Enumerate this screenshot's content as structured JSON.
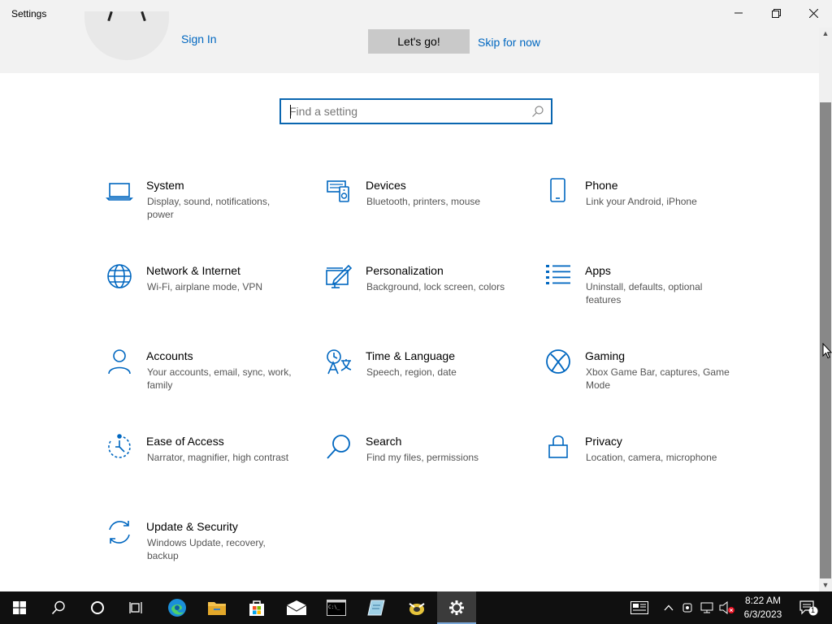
{
  "window": {
    "title": "Settings",
    "minimize_icon": "minimize-icon",
    "restore_icon": "restore-icon",
    "close_icon": "close-icon"
  },
  "banner": {
    "sign_in": "Sign In",
    "lets_go": "Let's go!",
    "skip": "Skip for now"
  },
  "search": {
    "placeholder": "Find a setting",
    "icon": "search-icon"
  },
  "accent_color": "#0067c0",
  "categories": [
    {
      "name": "System",
      "desc": "Display, sound, notifications, power",
      "icon": "laptop-icon"
    },
    {
      "name": "Devices",
      "desc": "Bluetooth, printers, mouse",
      "icon": "devices-icon"
    },
    {
      "name": "Phone",
      "desc": "Link your Android, iPhone",
      "icon": "phone-icon"
    },
    {
      "name": "Network & Internet",
      "desc": "Wi-Fi, airplane mode, VPN",
      "icon": "globe-icon"
    },
    {
      "name": "Personalization",
      "desc": "Background, lock screen, colors",
      "icon": "paint-icon"
    },
    {
      "name": "Apps",
      "desc": "Uninstall, defaults, optional features",
      "icon": "apps-list-icon"
    },
    {
      "name": "Accounts",
      "desc": "Your accounts, email, sync, work, family",
      "icon": "person-icon"
    },
    {
      "name": "Time & Language",
      "desc": "Speech, region, date",
      "icon": "time-language-icon"
    },
    {
      "name": "Gaming",
      "desc": "Xbox Game Bar, captures, Game Mode",
      "icon": "xbox-icon"
    },
    {
      "name": "Ease of Access",
      "desc": "Narrator, magnifier, high contrast",
      "icon": "ease-of-access-icon"
    },
    {
      "name": "Search",
      "desc": "Find my files, permissions",
      "icon": "magnifier-icon"
    },
    {
      "name": "Privacy",
      "desc": "Location, camera, microphone",
      "icon": "lock-icon"
    },
    {
      "name": "Update & Security",
      "desc": "Windows Update, recovery, backup",
      "icon": "sync-icon"
    }
  ],
  "taskbar": {
    "apps": [
      "start-icon",
      "search-icon",
      "cortana-icon",
      "task-view-icon",
      "edge-icon",
      "file-explorer-icon",
      "store-icon",
      "mail-icon",
      "terminal-icon",
      "notepad-icon",
      "app-icon",
      "settings-icon"
    ],
    "time": "8:22 AM",
    "date": "6/3/2023",
    "notification_count": "1"
  }
}
